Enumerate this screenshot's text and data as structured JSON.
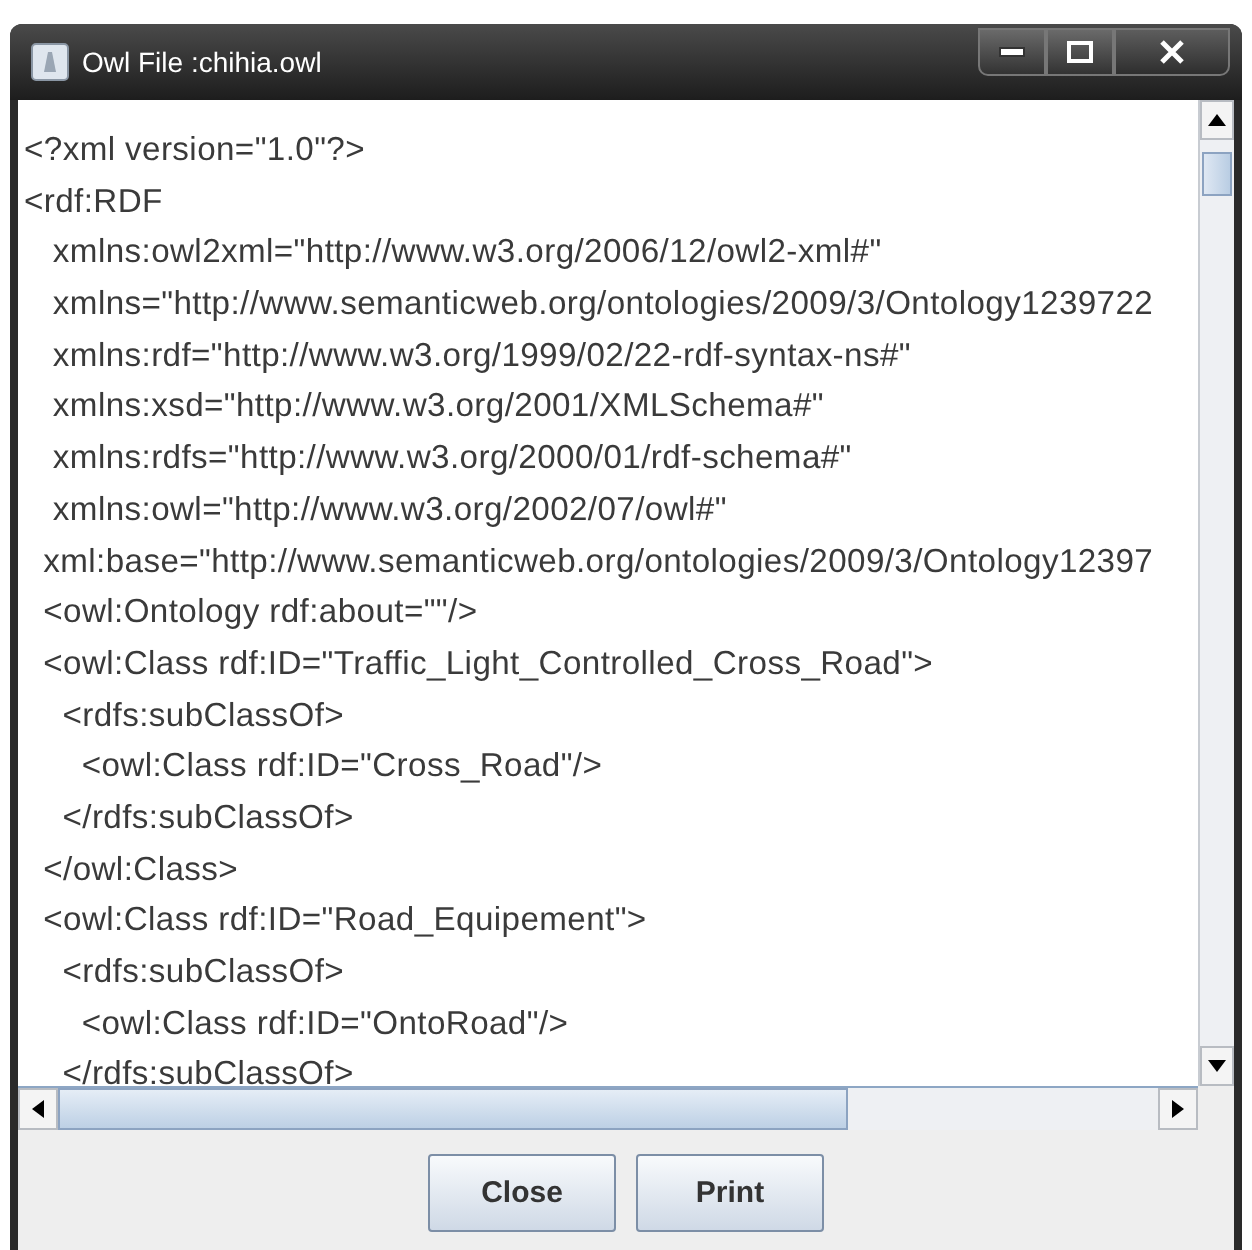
{
  "window": {
    "title": "Owl File :chihia.owl"
  },
  "text_lines": [
    "<?xml version=\"1.0\"?>",
    "<rdf:RDF",
    "   xmlns:owl2xml=\"http://www.w3.org/2006/12/owl2-xml#\"",
    "   xmlns=\"http://www.semanticweb.org/ontologies/2009/3/Ontology1239722",
    "   xmlns:rdf=\"http://www.w3.org/1999/02/22-rdf-syntax-ns#\"",
    "   xmlns:xsd=\"http://www.w3.org/2001/XMLSchema#\"",
    "   xmlns:rdfs=\"http://www.w3.org/2000/01/rdf-schema#\"",
    "   xmlns:owl=\"http://www.w3.org/2002/07/owl#\"",
    "  xml:base=\"http://www.semanticweb.org/ontologies/2009/3/Ontology12397",
    "  <owl:Ontology rdf:about=\"\"/>",
    "  <owl:Class rdf:ID=\"Traffic_Light_Controlled_Cross_Road\">",
    "    <rdfs:subClassOf>",
    "      <owl:Class rdf:ID=\"Cross_Road\"/>",
    "    </rdfs:subClassOf>",
    "  </owl:Class>",
    "  <owl:Class rdf:ID=\"Road_Equipement\">",
    "    <rdfs:subClassOf>",
    "      <owl:Class rdf:ID=\"OntoRoad\"/>",
    "    </rdfs:subClassOf>"
  ],
  "buttons": [
    {
      "label": "Close"
    },
    {
      "label": "Print"
    }
  ]
}
